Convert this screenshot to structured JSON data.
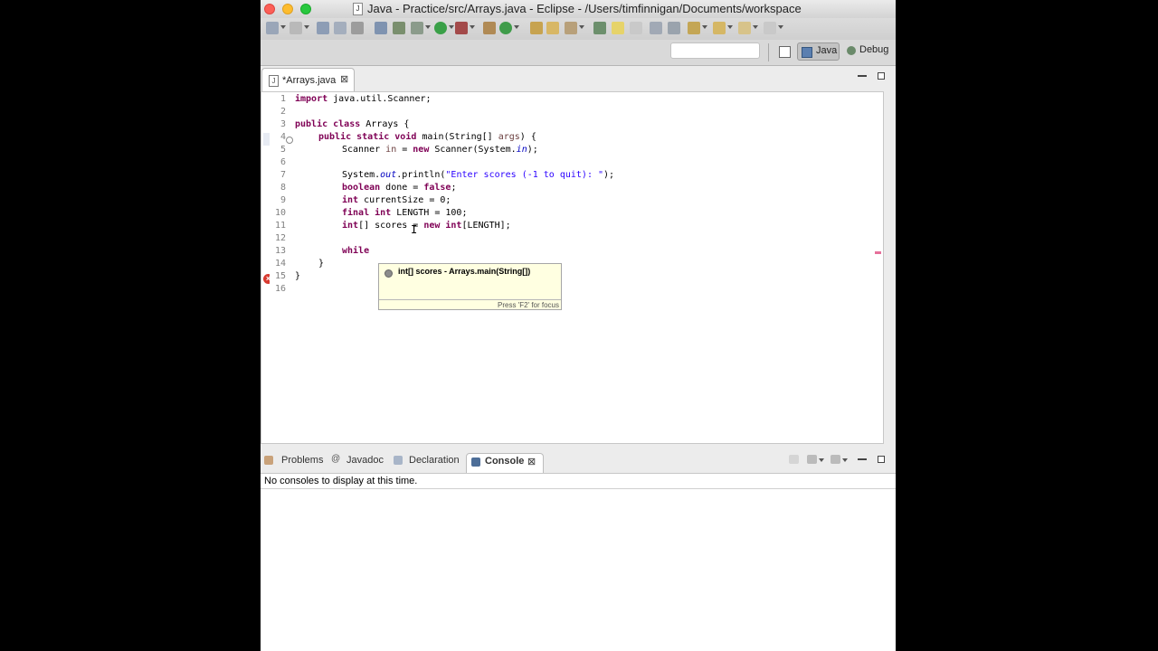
{
  "window": {
    "title": "Java - Practice/src/Arrays.java - Eclipse - /Users/timfinnigan/Documents/workspace"
  },
  "perspectives": {
    "java": "Java",
    "debug": "Debug"
  },
  "editor": {
    "tab_label": "*Arrays.java",
    "tab_close": "⊠",
    "line_numbers": [
      "1",
      "2",
      "3",
      "4",
      "5",
      "6",
      "7",
      "8",
      "9",
      "10",
      "11",
      "12",
      "13",
      "14",
      "15",
      "16"
    ],
    "code": {
      "l1_kw": "import",
      "l1_rest": " java.util.Scanner;",
      "l3_kw": "public class",
      "l3_rest": " Arrays {",
      "l4_kw": "public static void",
      "l4_a": " main(String[] ",
      "l4_arg": "args",
      "l4_b": ") {",
      "l5_a": "Scanner ",
      "l5_var": "in",
      "l5_b": " = ",
      "l5_kw": "new",
      "l5_c": " Scanner(System.",
      "l5_in": "in",
      "l5_d": ");",
      "l7_a": "System.",
      "l7_out": "out",
      "l7_b": ".println(",
      "l7_str": "\"Enter scores (-1 to quit): \"",
      "l7_c": ");",
      "l8_kw": "boolean",
      "l8_a": " done = ",
      "l8_kw2": "false",
      "l8_b": ";",
      "l9_kw": "int",
      "l9_a": " currentSize = 0;",
      "l10_kw": "final int",
      "l10_a": " LENGTH = 100;",
      "l11_kw": "int",
      "l11_a": "[] scores = ",
      "l11_kw2": "new",
      "l11_kw3": " int",
      "l11_b": "[LENGTH];",
      "l13_kw": "while",
      "l14": "}",
      "l15": "}"
    },
    "hover": {
      "text": "int[] scores - Arrays.main(String[])",
      "focus_hint": "Press 'F2' for focus"
    }
  },
  "bottom_panel": {
    "tabs": [
      "Problems",
      "Javadoc",
      "Declaration",
      "Console"
    ],
    "console_close": "⊠",
    "console_message": "No consoles to display at this time."
  },
  "colors": {
    "keyword": "#7f0055",
    "string": "#2a00ff",
    "field": "#0000c0",
    "tooltip_bg": "#ffffe1"
  }
}
